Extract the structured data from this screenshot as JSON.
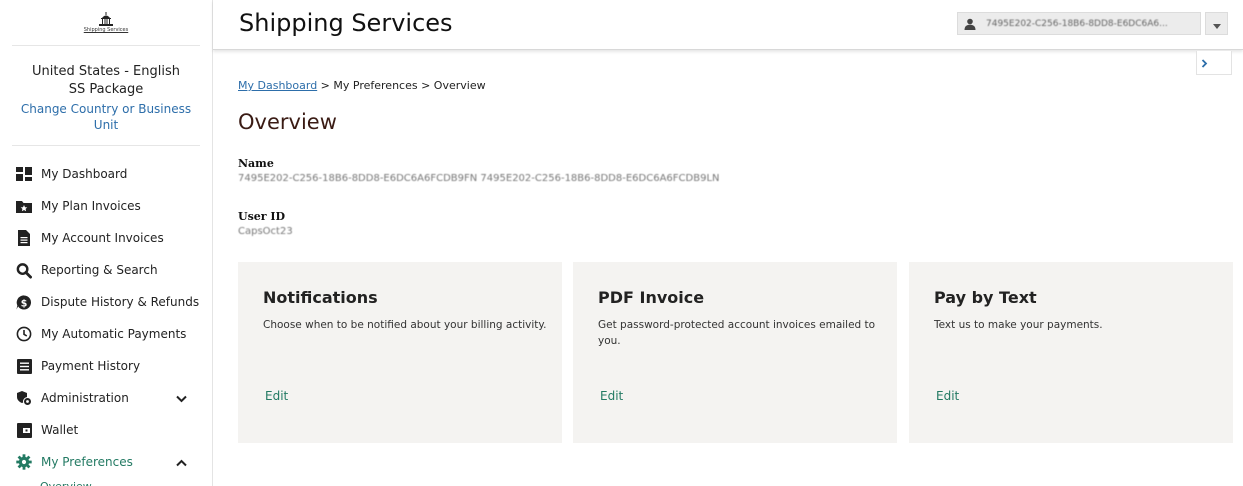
{
  "logo": {
    "text": "Shipping Services"
  },
  "sidebar": {
    "locale_line1": "United States - English",
    "locale_line2": "SS Package",
    "change_link": "Change Country or Business Unit",
    "items": [
      {
        "label": "My Dashboard",
        "icon": "dashboard-icon"
      },
      {
        "label": "My Plan Invoices",
        "icon": "folder-star-icon"
      },
      {
        "label": "My Account Invoices",
        "icon": "document-icon"
      },
      {
        "label": "Reporting & Search",
        "icon": "search-icon"
      },
      {
        "label": "Dispute History & Refunds",
        "icon": "dollar-icon"
      },
      {
        "label": "My Automatic Payments",
        "icon": "clock-icon"
      },
      {
        "label": "Payment History",
        "icon": "list-icon"
      },
      {
        "label": "Administration",
        "icon": "admin-icon"
      },
      {
        "label": "Wallet",
        "icon": "wallet-icon"
      },
      {
        "label": "My Preferences",
        "icon": "gear-icon"
      }
    ],
    "sub_items": [
      {
        "label": "Overview"
      }
    ]
  },
  "header": {
    "title": "Shipping Services",
    "user_name": "7495E202-C256-18B6-8DD8-E6DC6A6..."
  },
  "breadcrumb": {
    "link": "My Dashboard",
    "rest": " > My Preferences > Overview"
  },
  "page": {
    "title": "Overview",
    "name_label": "Name",
    "name_value": "7495E202-C256-18B6-8DD8-E6DC6A6FCDB9FN 7495E202-C256-18B6-8DD8-E6DC6A6FCDB9LN",
    "userid_label": "User ID",
    "userid_value": "CapsOct23"
  },
  "cards": [
    {
      "title": "Notifications",
      "desc": "Choose when to be notified about your billing activity.",
      "edit": "Edit"
    },
    {
      "title": "PDF Invoice",
      "desc": "Get password-protected account invoices emailed to you.",
      "edit": "Edit"
    },
    {
      "title": "Pay by Text",
      "desc": "Text us to make your payments.",
      "edit": "Edit"
    }
  ],
  "colors": {
    "accent": "#237a63",
    "link": "#2d6eaa",
    "card_bg": "#f4f3f1"
  }
}
